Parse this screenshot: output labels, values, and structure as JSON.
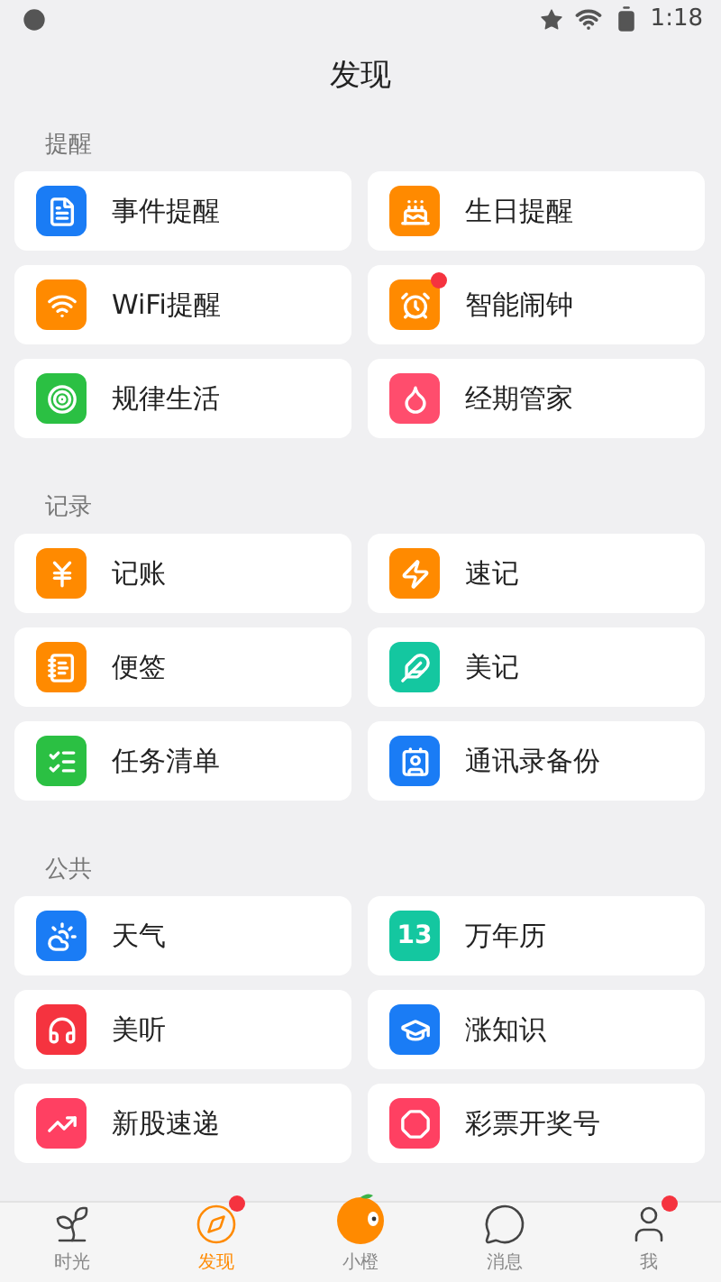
{
  "status_bar": {
    "time": "1:18"
  },
  "title": "发现",
  "sections": [
    {
      "label": "提醒",
      "items": [
        {
          "label": "事件提醒",
          "color": "#1a7cf5",
          "badge": false
        },
        {
          "label": "生日提醒",
          "color": "#ff8a00",
          "badge": false
        },
        {
          "label": "WiFi提醒",
          "color": "#ff8a00",
          "badge": false
        },
        {
          "label": "智能闹钟",
          "color": "#ff8a00",
          "badge": true
        },
        {
          "label": "规律生活",
          "color": "#2bc043",
          "badge": false
        },
        {
          "label": "经期管家",
          "color": "#ff4d6d",
          "badge": false
        }
      ]
    },
    {
      "label": "记录",
      "items": [
        {
          "label": "记账",
          "color": "#ff8a00",
          "badge": false
        },
        {
          "label": "速记",
          "color": "#ff8a00",
          "badge": false
        },
        {
          "label": "便签",
          "color": "#ff8a00",
          "badge": false
        },
        {
          "label": "美记",
          "color": "#14c7a0",
          "badge": false
        },
        {
          "label": "任务清单",
          "color": "#2bc043",
          "badge": false
        },
        {
          "label": "通讯录备份",
          "color": "#1a7cf5",
          "badge": false
        }
      ]
    },
    {
      "label": "公共",
      "items": [
        {
          "label": "天气",
          "color": "#1a7cf5",
          "badge": false
        },
        {
          "label": "万年历",
          "color": "#14c7a0",
          "badge": false,
          "icon_text": "13"
        },
        {
          "label": "美听",
          "color": "#f5333f",
          "badge": false
        },
        {
          "label": "涨知识",
          "color": "#1a7cf5",
          "badge": false
        },
        {
          "label": "新股速递",
          "color": "#ff4062",
          "badge": false
        },
        {
          "label": "彩票开奖号",
          "color": "#ff4062",
          "badge": false
        }
      ]
    }
  ],
  "tabs": [
    {
      "label": "时光",
      "selected": false,
      "badge": false
    },
    {
      "label": "发现",
      "selected": true,
      "badge": true
    },
    {
      "label": "小橙",
      "selected": false,
      "badge": false
    },
    {
      "label": "消息",
      "selected": false,
      "badge": false
    },
    {
      "label": "我",
      "selected": false,
      "badge": true
    }
  ]
}
